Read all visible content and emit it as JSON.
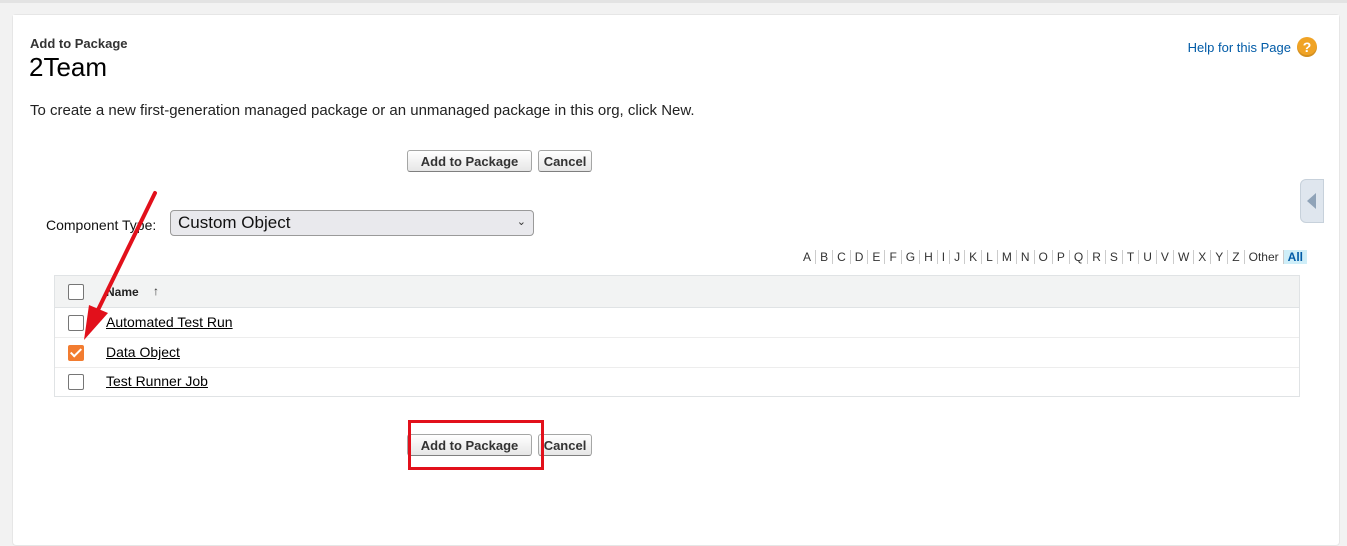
{
  "header": {
    "breadcrumb": "Add to Package",
    "title": "2Team",
    "help_label": "Help for this Page",
    "help_icon": "question-icon"
  },
  "intro_text": "To create a new first-generation managed package or an unmanaged package in this org, click New.",
  "buttons": {
    "add_to_package": "Add to Package",
    "cancel": "Cancel"
  },
  "component_type": {
    "label": "Component Type:",
    "selected": "Custom Object"
  },
  "alphabet": [
    "A",
    "B",
    "C",
    "D",
    "E",
    "F",
    "G",
    "H",
    "I",
    "J",
    "K",
    "L",
    "M",
    "N",
    "O",
    "P",
    "Q",
    "R",
    "S",
    "T",
    "U",
    "V",
    "W",
    "X",
    "Y",
    "Z",
    "Other",
    "All"
  ],
  "alphabet_selected": "All",
  "table": {
    "header_name": "Name",
    "sort_icon": "↑",
    "rows": [
      {
        "name": "Automated Test Run",
        "checked": false
      },
      {
        "name": "Data Object",
        "checked": true
      },
      {
        "name": "Test Runner Job",
        "checked": false
      }
    ]
  },
  "colors": {
    "link": "#015ba7",
    "checkbox_checked": "#f27c30",
    "annotation": "#e2101b",
    "help_icon": "#f0a325"
  }
}
